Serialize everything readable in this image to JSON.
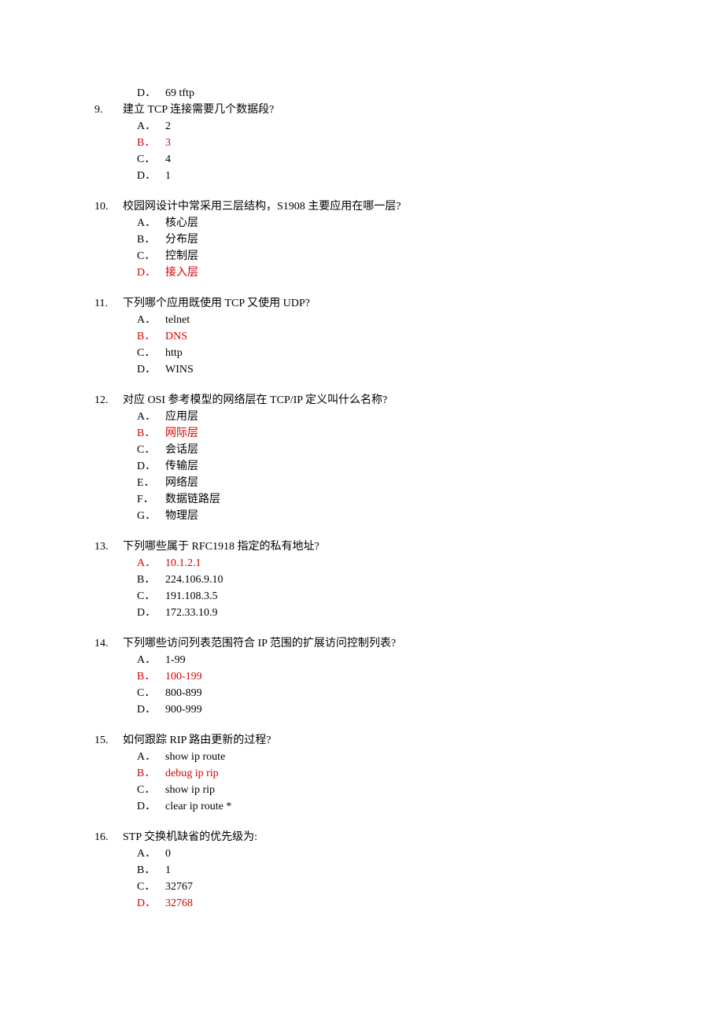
{
  "orphan_option": {
    "letter": "D．",
    "text": "69 tftp",
    "is_answer": false
  },
  "questions": [
    {
      "number": "9.",
      "text": "建立 TCP 连接需要几个数据段?",
      "options": [
        {
          "letter": "A．",
          "text": "2",
          "is_answer": false
        },
        {
          "letter": "B．",
          "text": "3",
          "is_answer": true
        },
        {
          "letter": "C．",
          "text": "4",
          "is_answer": false
        },
        {
          "letter": "D．",
          "text": "1",
          "is_answer": false
        }
      ]
    },
    {
      "number": "10.",
      "text": "校园网设计中常采用三层结构，S1908 主要应用在哪一层?",
      "options": [
        {
          "letter": "A．",
          "text": "核心层",
          "is_answer": false
        },
        {
          "letter": "B．",
          "text": "分布层",
          "is_answer": false
        },
        {
          "letter": "C．",
          "text": "控制层",
          "is_answer": false
        },
        {
          "letter": "D．",
          "text": "接入层",
          "is_answer": true
        }
      ]
    },
    {
      "number": "11.",
      "text": "下列哪个应用既使用 TCP 又使用 UDP?",
      "options": [
        {
          "letter": "A．",
          "text": "telnet",
          "is_answer": false
        },
        {
          "letter": "B．",
          "text": "DNS",
          "is_answer": true
        },
        {
          "letter": "C．",
          "text": "http",
          "is_answer": false
        },
        {
          "letter": "D．",
          "text": "WINS",
          "is_answer": false
        }
      ]
    },
    {
      "number": "12.",
      "text": "对应 OSI 参考模型的网络层在 TCP/IP 定义叫什么名称?",
      "options": [
        {
          "letter": "A．",
          "text": "应用层",
          "is_answer": false
        },
        {
          "letter": "B．",
          "text": "网际层",
          "is_answer": true
        },
        {
          "letter": "C．",
          "text": "会话层",
          "is_answer": false
        },
        {
          "letter": "D．",
          "text": "传输层",
          "is_answer": false
        },
        {
          "letter": "E．",
          "text": "网络层",
          "is_answer": false
        },
        {
          "letter": "F．",
          "text": "数据链路层",
          "is_answer": false
        },
        {
          "letter": "G．",
          "text": "物理层",
          "is_answer": false
        }
      ]
    },
    {
      "number": "13.",
      "text": "下列哪些属于 RFC1918 指定的私有地址?",
      "options": [
        {
          "letter": "A．",
          "text": "10.1.2.1",
          "is_answer": true
        },
        {
          "letter": "B．",
          "text": "224.106.9.10",
          "is_answer": false
        },
        {
          "letter": "C．",
          "text": "191.108.3.5",
          "is_answer": false
        },
        {
          "letter": "D．",
          "text": "172.33.10.9",
          "is_answer": false
        }
      ]
    },
    {
      "number": "14.",
      "text": "下列哪些访问列表范围符合 IP 范围的扩展访问控制列表?",
      "options": [
        {
          "letter": "A．",
          "text": "1-99",
          "is_answer": false
        },
        {
          "letter": "B．",
          "text": "100-199",
          "is_answer": true
        },
        {
          "letter": "C．",
          "text": "800-899",
          "is_answer": false
        },
        {
          "letter": "D．",
          "text": "900-999",
          "is_answer": false
        }
      ]
    },
    {
      "number": "15.",
      "text": "如何跟踪 RIP 路由更新的过程?",
      "options": [
        {
          "letter": "A．",
          "text": "show ip route",
          "is_answer": false
        },
        {
          "letter": "B．",
          "text": "debug ip rip",
          "is_answer": true
        },
        {
          "letter": "C．",
          "text": "show ip rip",
          "is_answer": false
        },
        {
          "letter": "D．",
          "text": "clear ip route *",
          "is_answer": false
        }
      ]
    },
    {
      "number": "16.",
      "text": "STP 交换机缺省的优先级为:",
      "options": [
        {
          "letter": "A．",
          "text": "0",
          "is_answer": false
        },
        {
          "letter": "B．",
          "text": "1",
          "is_answer": false
        },
        {
          "letter": "C．",
          "text": "32767",
          "is_answer": false
        },
        {
          "letter": "D．",
          "text": "32768",
          "is_answer": true
        }
      ]
    }
  ]
}
